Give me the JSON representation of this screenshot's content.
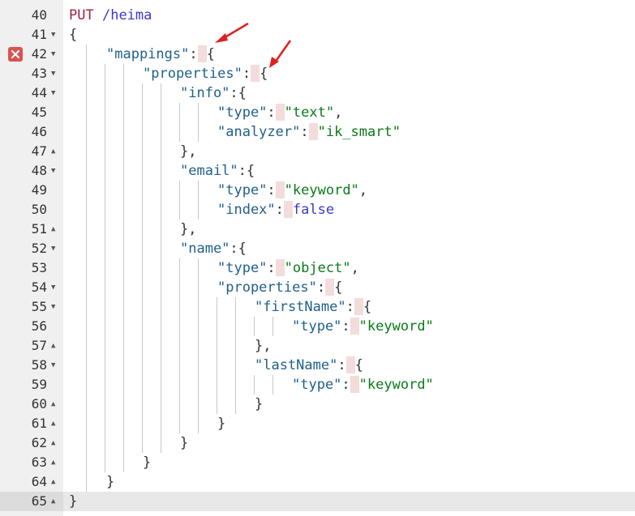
{
  "lines": [
    {
      "n": "40",
      "fold": ""
    },
    {
      "n": "41",
      "fold": "▼"
    },
    {
      "n": "42",
      "fold": "▼",
      "error": true
    },
    {
      "n": "43",
      "fold": "▼"
    },
    {
      "n": "44",
      "fold": "▼"
    },
    {
      "n": "45",
      "fold": ""
    },
    {
      "n": "46",
      "fold": ""
    },
    {
      "n": "47",
      "fold": "▲"
    },
    {
      "n": "48",
      "fold": "▼"
    },
    {
      "n": "49",
      "fold": ""
    },
    {
      "n": "50",
      "fold": ""
    },
    {
      "n": "51",
      "fold": "▲"
    },
    {
      "n": "52",
      "fold": "▼"
    },
    {
      "n": "53",
      "fold": ""
    },
    {
      "n": "54",
      "fold": "▼"
    },
    {
      "n": "55",
      "fold": "▼"
    },
    {
      "n": "56",
      "fold": ""
    },
    {
      "n": "57",
      "fold": "▲"
    },
    {
      "n": "58",
      "fold": "▼"
    },
    {
      "n": "59",
      "fold": ""
    },
    {
      "n": "60",
      "fold": "▲"
    },
    {
      "n": "61",
      "fold": "▲"
    },
    {
      "n": "62",
      "fold": "▲"
    },
    {
      "n": "63",
      "fold": "▲"
    },
    {
      "n": "64",
      "fold": "▲"
    },
    {
      "n": "65",
      "fold": "▲"
    }
  ],
  "code": {
    "method": "PUT",
    "path": "/heima",
    "open_brace": "{",
    "close_brace": "}",
    "k_mappings": "\"mappings\"",
    "k_properties": "\"properties\"",
    "k_info": "\"info\"",
    "k_type": "\"type\"",
    "k_analyzer": "\"analyzer\"",
    "k_email": "\"email\"",
    "k_index": "\"index\"",
    "k_name": "\"name\"",
    "k_firstName": "\"firstName\"",
    "k_lastName": "\"lastName\"",
    "v_text": "\"text\"",
    "v_ik_smart": "\"ik_smart\"",
    "v_keyword": "\"keyword\"",
    "v_false": "false",
    "v_object": "\"object\""
  },
  "colors": {
    "keys": "#1f5f8a",
    "strings": "#0b7a1a",
    "boolean": "#3b39c9",
    "method": "#a0243b",
    "error": "#d9534f",
    "arrow": "#e02020"
  },
  "icons": {
    "error": "error-x-icon",
    "arrow": "red-arrow-annotation"
  }
}
